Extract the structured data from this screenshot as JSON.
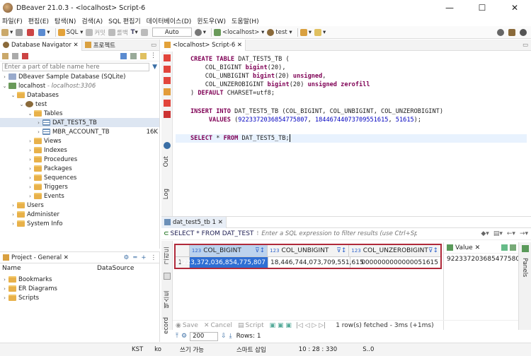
{
  "window": {
    "title": "DBeaver 21.0.3 - <localhost> Script-6",
    "minimize": "—",
    "maximize": "☐",
    "close": "✕"
  },
  "menu": [
    "파일(F)",
    "편집(E)",
    "탐색(N)",
    "검색(A)",
    "SQL 편집기",
    "데이터베이스(D)",
    "윈도우(W)",
    "도움말(H)"
  ],
  "toolbar": {
    "sql": "SQL",
    "commit": "커밋",
    "rollback": "롤백",
    "mode": "Auto",
    "connection": "<localhost>",
    "schema": "test"
  },
  "navigator": {
    "tab1": "Database Navigator",
    "tab2": "프로젝트",
    "filter_placeholder": "Enter a part of table name here",
    "items": {
      "sample": "DBeaver Sample Database (SQLite)",
      "localhost": "localhost",
      "localhost_host": "- localhost:3306",
      "databases": "Databases",
      "test": "test",
      "tables": "Tables",
      "t1": "DAT_TEST5_TB",
      "t2": "MBR_ACCOUNT_TB",
      "t2size": "16K",
      "views": "Views",
      "indexes": "Indexes",
      "procedures": "Procedures",
      "packages": "Packages",
      "sequences": "Sequences",
      "triggers": "Triggers",
      "events": "Events",
      "users": "Users",
      "administer": "Administer",
      "sysinfo": "System Info"
    }
  },
  "project": {
    "tab": "Project - General",
    "col_name": "Name",
    "col_ds": "DataSource",
    "items": [
      "Bookmarks",
      "ER Diagrams",
      "Scripts"
    ]
  },
  "editor": {
    "tab": "<localhost> Script-6",
    "side": {
      "out": "Out",
      "log": "Log"
    },
    "sql": {
      "l1a": "CREATE TABLE",
      "l1b": " DAT_TEST5_TB (",
      "l2a": "    COL_BIGINT ",
      "l2b": "bigint",
      "l2c": "(20),",
      "l3a": "    COL_UNBIGINT ",
      "l3b": "bigint",
      "l3c": "(20) ",
      "l3d": "unsigned",
      ",l3e": ",",
      "l4a": "    COL_UNZEROBIGINT ",
      "l4b": "bigint",
      "l4c": "(20) ",
      "l4d": "unsigned zerofill",
      "l5a": ") ",
      "l5b": "DEFAULT",
      "l5c": " CHARSET=utf8;",
      "l7a": "INSERT INTO",
      "l7b": " DAT_TEST5_TB (COL_BIGINT, COL_UNBIGINT, COL_UNZEROBIGINT)",
      "l8a": "     VALUES",
      "l8b": " (",
      "l8c": "9223372036854775807",
      "l8d": ", ",
      "l8e": "18446744073709551615",
      "l8f": ", ",
      "l8g": "51615",
      "l8h": ");",
      "l10a": "SELECT",
      "l10b": " * ",
      "l10c": "FROM",
      "l10d": " DAT_TEST5_TB;"
    }
  },
  "results": {
    "tab": "dat_test5_tb 1",
    "query": "SELECT * FROM DAT_TEST5",
    "filter_placeholder": "Enter a SQL expression to filter results (use Ctrl+Sp",
    "columns": [
      "COL_BIGINT",
      "COL_UNBIGINT",
      "COL_UNZEROBIGINT"
    ],
    "coltype": "123",
    "rows": [
      {
        "n": "1",
        "c1": "9,223,372,036,854,775,807",
        "c2": "18,446,744,073,709,551,615",
        "c3": "0000000000000051615"
      }
    ],
    "side": {
      "grid": "그리드",
      "text": "텍스트",
      "record": "ecord"
    },
    "footer": {
      "save": "Save",
      "cancel": "Cancel",
      "script": "Script",
      "fetch": "200",
      "rows": "Rows: 1",
      "status": "1 row(s) fetched - 3ms (+1ms)"
    }
  },
  "value_panel": {
    "title": "Value",
    "value": "9223372036854775807",
    "panels": "Panels"
  },
  "status": {
    "tz": "KST",
    "lang": "ko",
    "write": "쓰기 가능",
    "insert": "스마트 삽입",
    "pos": "10 : 28 : 330",
    "sel": "S..0"
  }
}
